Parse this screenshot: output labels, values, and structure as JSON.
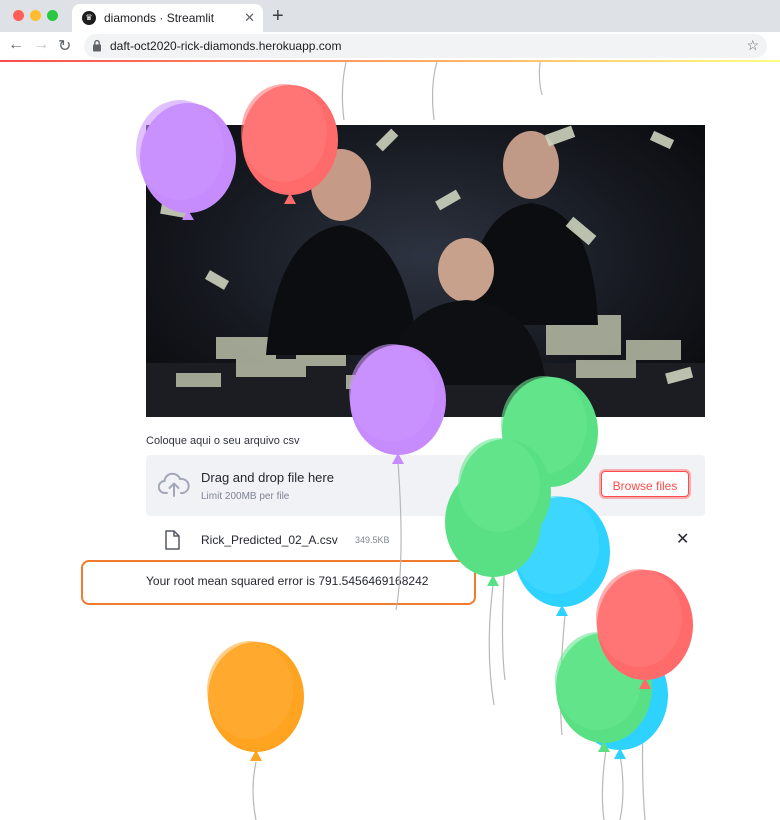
{
  "browser": {
    "tab_title": "diamonds · Streamlit",
    "url": "daft-oct2020-rick-diamonds.herokuapp.com",
    "favicon_icon": "streamlit-crown-icon"
  },
  "uploader": {
    "label": "Coloque aqui o seu arquivo csv",
    "dropzone_title": "Drag and drop file here",
    "dropzone_limit": "Limit 200MB per file",
    "browse_label": "Browse files",
    "accent_color": "#ff4b4b"
  },
  "uploaded_file": {
    "name": "Rick_Predicted_02_A.csv",
    "size": "349.5KB"
  },
  "result": {
    "text": "Your root mean squared error is 791.5456469168242",
    "highlight_color": "#f07b2d"
  },
  "balloon_colors": [
    "#c68bfc",
    "#ff6b6b",
    "#5ae084",
    "#2ed2ff",
    "#ffa421"
  ]
}
